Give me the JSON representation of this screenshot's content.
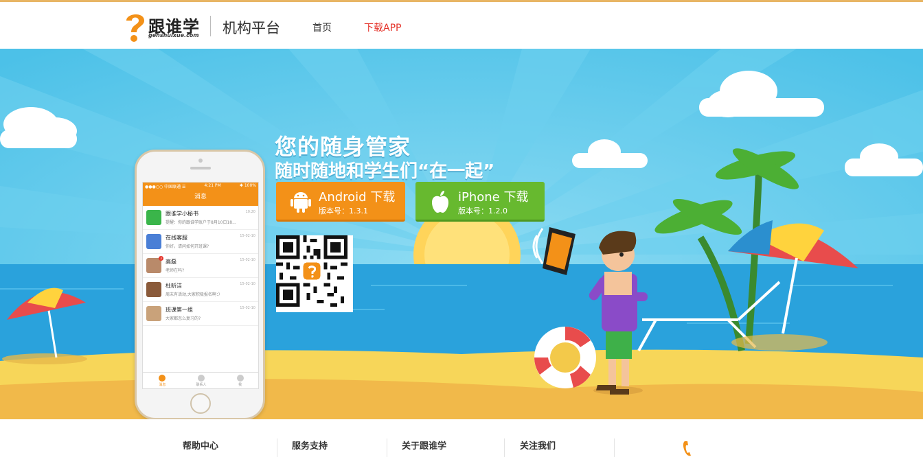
{
  "header": {
    "logo_text": "跟谁学",
    "logo_sub": "genshuixue.com",
    "platform": "机构平台",
    "nav": [
      {
        "label": "首页"
      },
      {
        "label": "下载APP"
      }
    ]
  },
  "banner": {
    "headline1": "您的随身管家",
    "headline2": "随时随地和学生们“在一起”",
    "android": {
      "title": "Android 下载",
      "version": "版本号：1.3.1"
    },
    "iphone": {
      "title": "iPhone 下载",
      "version": "版本号：1.2.0"
    }
  },
  "phone": {
    "status_left": "●●●○○ 中国联通 ☰",
    "status_time": "4:21 PM",
    "status_right": "✱ 100%",
    "app_title": "消息",
    "messages": [
      {
        "name": "跟谁学小秘书",
        "preview": "提醒：你的跟谁学账户于8月10日18...",
        "time": "10:20",
        "badge": ""
      },
      {
        "name": "在线客服",
        "preview": "你好，请问如何开班课?",
        "time": "15-02-10",
        "badge": ""
      },
      {
        "name": "高磊",
        "preview": "老师在吗?",
        "time": "15-02-10",
        "badge": "3"
      },
      {
        "name": "杜昕洁",
        "preview": "周末有活动,大家积极报名啊：）",
        "time": "15-02-10",
        "badge": ""
      },
      {
        "name": "班课第一组",
        "preview": "大家都怎么复习的?",
        "time": "15-02-10",
        "badge": ""
      }
    ],
    "tabs": [
      "消息",
      "联系人",
      "我"
    ]
  },
  "footer": {
    "links": [
      {
        "label": "帮助中心"
      },
      {
        "label": "服务支持"
      },
      {
        "label": "关于跟谁学"
      },
      {
        "label": "关注我们"
      }
    ]
  },
  "colors": {
    "accent_orange": "#f39118",
    "accent_green": "#67b92f",
    "nav_red": "#e5332a",
    "sky": "#53c6ea"
  }
}
